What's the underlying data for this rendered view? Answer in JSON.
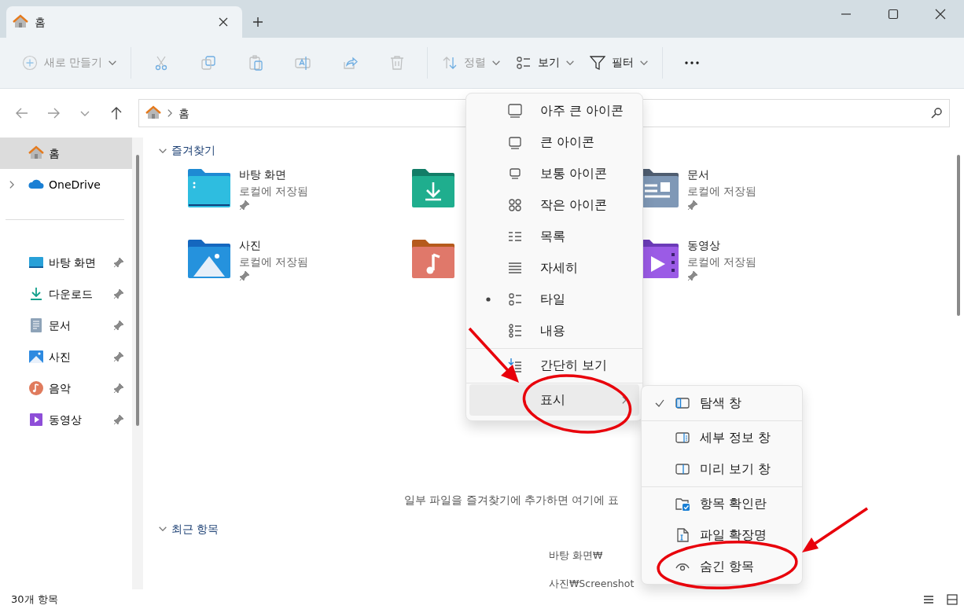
{
  "window": {
    "tab_title": "홈"
  },
  "toolbar": [
    {
      "kind": "new",
      "label": "새로 만들기",
      "disabled": true
    },
    {
      "kind": "cut",
      "disabled": true
    },
    {
      "kind": "copy",
      "disabled": true
    },
    {
      "kind": "paste",
      "disabled": true
    },
    {
      "kind": "rename",
      "disabled": true
    },
    {
      "kind": "share",
      "disabled": true
    },
    {
      "kind": "delete",
      "disabled": true
    },
    {
      "kind": "sort",
      "label": "정렬",
      "disabled": true
    },
    {
      "kind": "view",
      "label": "보기",
      "disabled": false
    },
    {
      "kind": "filter",
      "label": "필터",
      "disabled": false
    },
    {
      "kind": "more",
      "disabled": false
    }
  ],
  "address": {
    "path": "홈"
  },
  "sidebar": {
    "items": [
      {
        "label": "홈",
        "selected": true,
        "expandable": false
      },
      {
        "label": "OneDrive",
        "selected": false,
        "expandable": true
      }
    ],
    "pinned": [
      {
        "label": "바탕 화면",
        "selected": false
      },
      {
        "label": "다운로드",
        "selected": false
      },
      {
        "label": "문서",
        "selected": false
      },
      {
        "label": "사진",
        "selected": false
      },
      {
        "label": "음악",
        "selected": false
      },
      {
        "label": "동영상",
        "selected": false
      }
    ]
  },
  "favorites": {
    "title": "즐겨찾기",
    "expanded": true,
    "items": [
      {
        "kind": "tile",
        "name": "바탕 화면",
        "location": "로컬에 저장됨"
      },
      {
        "kind": "covered"
      },
      {
        "kind": "tile",
        "name": "문서",
        "location": "로컬에 저장됨"
      },
      {
        "kind": "tile",
        "name": "사진",
        "location": "로컬에 저장됨"
      },
      {
        "kind": "covered"
      },
      {
        "kind": "tile",
        "name": "동영상",
        "location": "로컬에 저장됨"
      }
    ],
    "empty_note": "일부 파일을 즐겨찾기에 추가하면 여기에 표"
  },
  "recent": {
    "title": "최근 항목",
    "expanded": true,
    "items": [
      "바탕 화면₩",
      "사진₩Screenshot"
    ]
  },
  "status_bar": {
    "count": "30개 항목"
  },
  "view_menu": {
    "items": [
      {
        "kind": "layout",
        "label": "아주 큰 아이콘",
        "selected": false
      },
      {
        "kind": "layout",
        "label": "큰 아이콘",
        "selected": false
      },
      {
        "kind": "layout",
        "label": "보통 아이콘",
        "selected": false
      },
      {
        "kind": "layout",
        "label": "작은 아이콘",
        "selected": false
      },
      {
        "kind": "layout",
        "label": "목록",
        "selected": false
      },
      {
        "kind": "layout",
        "label": "자세히",
        "selected": false
      },
      {
        "kind": "layout",
        "label": "타일",
        "selected": true
      },
      {
        "kind": "layout",
        "label": "내용",
        "selected": false
      },
      {
        "kind": "toggle",
        "label": "간단히 보기",
        "checked": false
      },
      {
        "kind": "submenu",
        "label": "표시",
        "highlighted": true
      }
    ]
  },
  "show_submenu": {
    "items": [
      {
        "label": "탐색 창",
        "checked": true
      },
      {
        "label": "세부 정보 창",
        "checked": false
      },
      {
        "label": "미리 보기 창",
        "checked": false
      },
      {
        "label": "항목 확인란",
        "checked": false
      },
      {
        "label": "파일 확장명",
        "checked": false
      },
      {
        "label": "숨긴 항목",
        "checked": false
      }
    ]
  }
}
